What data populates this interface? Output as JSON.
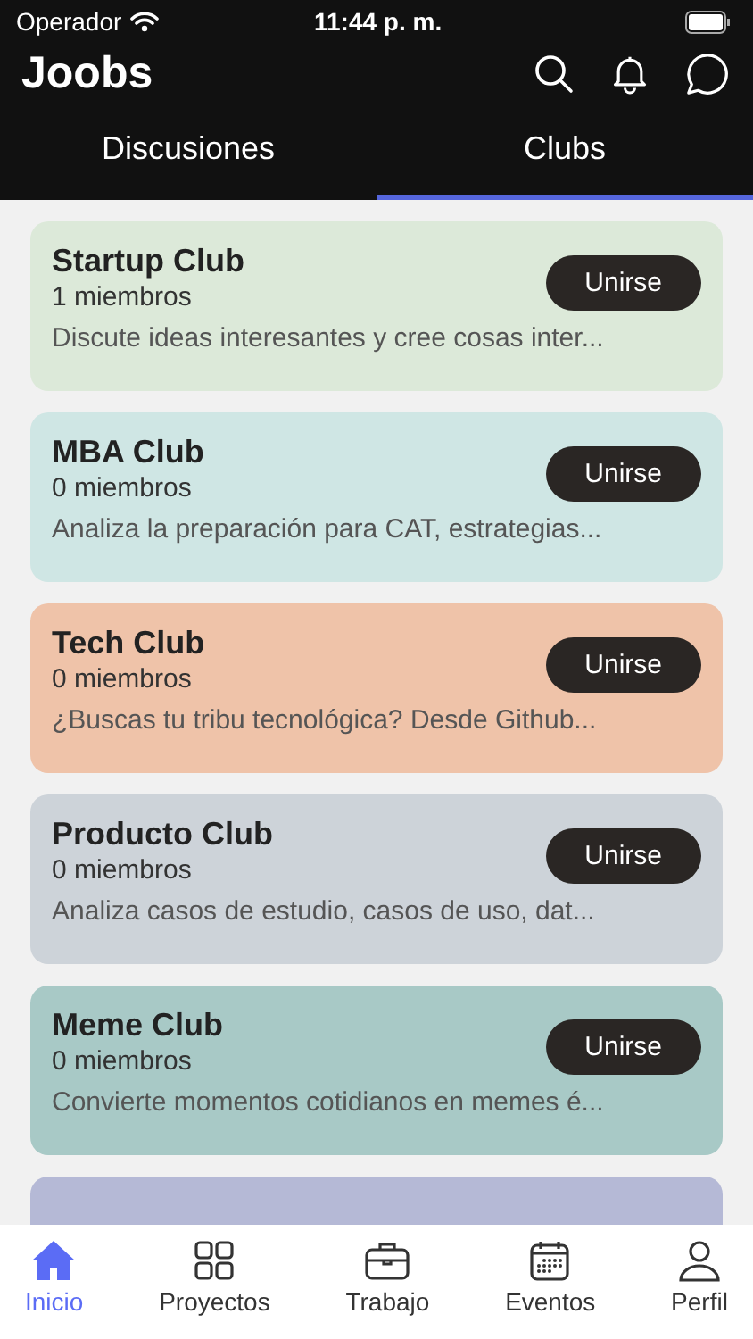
{
  "status_bar": {
    "carrier": "Operador",
    "time": "11:44 p. m."
  },
  "header": {
    "title": "Joobs"
  },
  "tabs": [
    {
      "label": "Discusiones",
      "selected": false
    },
    {
      "label": "Clubs",
      "selected": true
    }
  ],
  "clubs": [
    {
      "title": "Startup Club",
      "members": "1 miembros",
      "description": "Discute ideas interesantes y cree cosas inter...",
      "button": "Unirse",
      "color": "#dce9d9"
    },
    {
      "title": "MBA Club",
      "members": "0 miembros",
      "description": "Analiza la preparación para CAT, estrategias...",
      "button": "Unirse",
      "color": "#cfe6e4"
    },
    {
      "title": "Tech Club",
      "members": "0 miembros",
      "description": "¿Buscas tu tribu tecnológica? Desde Github...",
      "button": "Unirse",
      "color": "#efc3a9"
    },
    {
      "title": "Producto Club",
      "members": "0 miembros",
      "description": "Analiza casos de estudio, casos de uso, dat...",
      "button": "Unirse",
      "color": "#cdd3d9"
    },
    {
      "title": "Meme Club",
      "members": "0 miembros",
      "description": "Convierte momentos cotidianos en memes é...",
      "button": "Unirse",
      "color": "#a8c9c6"
    },
    {
      "color": "#b5b9d6"
    }
  ],
  "bottom_nav": [
    {
      "label": "Inicio",
      "kind": "home",
      "selected": true
    },
    {
      "label": "Proyectos",
      "kind": "grid",
      "selected": false
    },
    {
      "label": "Trabajo",
      "kind": "briefcase",
      "selected": false
    },
    {
      "label": "Eventos",
      "kind": "calendar",
      "selected": false
    },
    {
      "label": "Perfil",
      "kind": "person",
      "selected": false
    }
  ]
}
